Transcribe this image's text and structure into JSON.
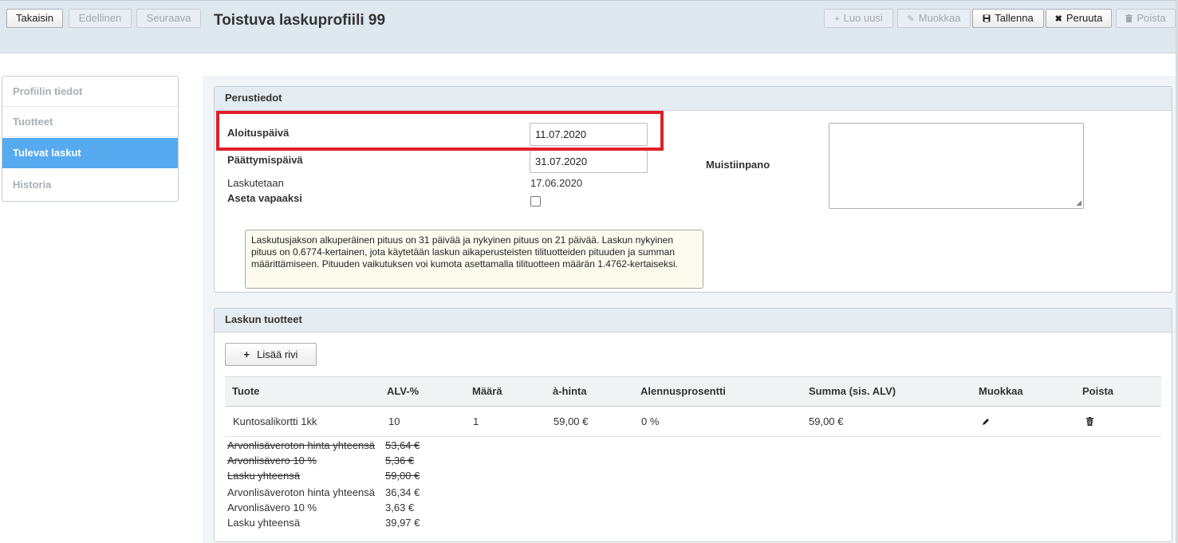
{
  "toolbar": {
    "back": "Takaisin",
    "previous": "Edellinen",
    "next": "Seuraava",
    "title": "Toistuva laskuprofiili 99",
    "create_new": "Luo uusi",
    "edit": "Muokkaa",
    "save": "Tallenna",
    "cancel": "Peruuta",
    "delete": "Poista"
  },
  "sidebar": {
    "items": [
      {
        "label": "Profiilin tiedot"
      },
      {
        "label": "Tuotteet"
      },
      {
        "label": "Tulevat laskut"
      },
      {
        "label": "Historia"
      }
    ],
    "active": "Tulevat laskut"
  },
  "basic": {
    "title": "Perustiedot",
    "start_label": "Aloituspäivä",
    "start_value": "11.07.2020",
    "end_label": "Päättymispäivä",
    "end_value": "31.07.2020",
    "billed_label": "Laskutetaan",
    "billed_value": "17.06.2020",
    "free_label": "Aseta vapaaksi",
    "free_checked": false,
    "note_label": "Muistiinpano",
    "note_value": "",
    "info": "Laskutusjakson alkuperäinen pituus on 31 päivää ja nykyinen pituus on 21 päivää. Laskun nykyinen pituus on 0.6774-kertainen, jota käytetään laskun aikaperusteisten tilituotteiden pituuden ja summan määrittämiseen. Pituuden vaikutuksen voi kumota asettamalla tilituotteen määrän 1.4762-kertaiseksi."
  },
  "products": {
    "title": "Laskun tuotteet",
    "add_row": "Lisää rivi",
    "columns": [
      "Tuote",
      "ALV-%",
      "Määrä",
      "à-hinta",
      "Alennusprosentti",
      "Summa (sis. ALV)",
      "Muokkaa",
      "Poista"
    ],
    "rows": [
      {
        "product": "Kuntosalikortti 1kk",
        "vat": "10",
        "qty": "1",
        "unit_price": "59,00 €",
        "discount": "0 %",
        "sum": "59,00 €"
      }
    ],
    "old_totals": [
      {
        "label": "Arvonlisäveroton hinta yhteensä",
        "value": "53,64 €"
      },
      {
        "label": "Arvonlisävero 10 %",
        "value": "5,36 €"
      },
      {
        "label": "Lasku yhteensä",
        "value": "59,00 €"
      }
    ],
    "totals": [
      {
        "label": "Arvonlisäveroton hinta yhteensä",
        "value": "36,34 €"
      },
      {
        "label": "Arvonlisävero 10 %",
        "value": "3,63 €"
      },
      {
        "label": "Lasku yhteensä",
        "value": "39,97 €"
      }
    ]
  },
  "colors": {
    "active_nav": "#55aaf0",
    "highlight": "#e0202a",
    "panel_header": "#e4ebf1",
    "info_box": "#fcfbee"
  }
}
